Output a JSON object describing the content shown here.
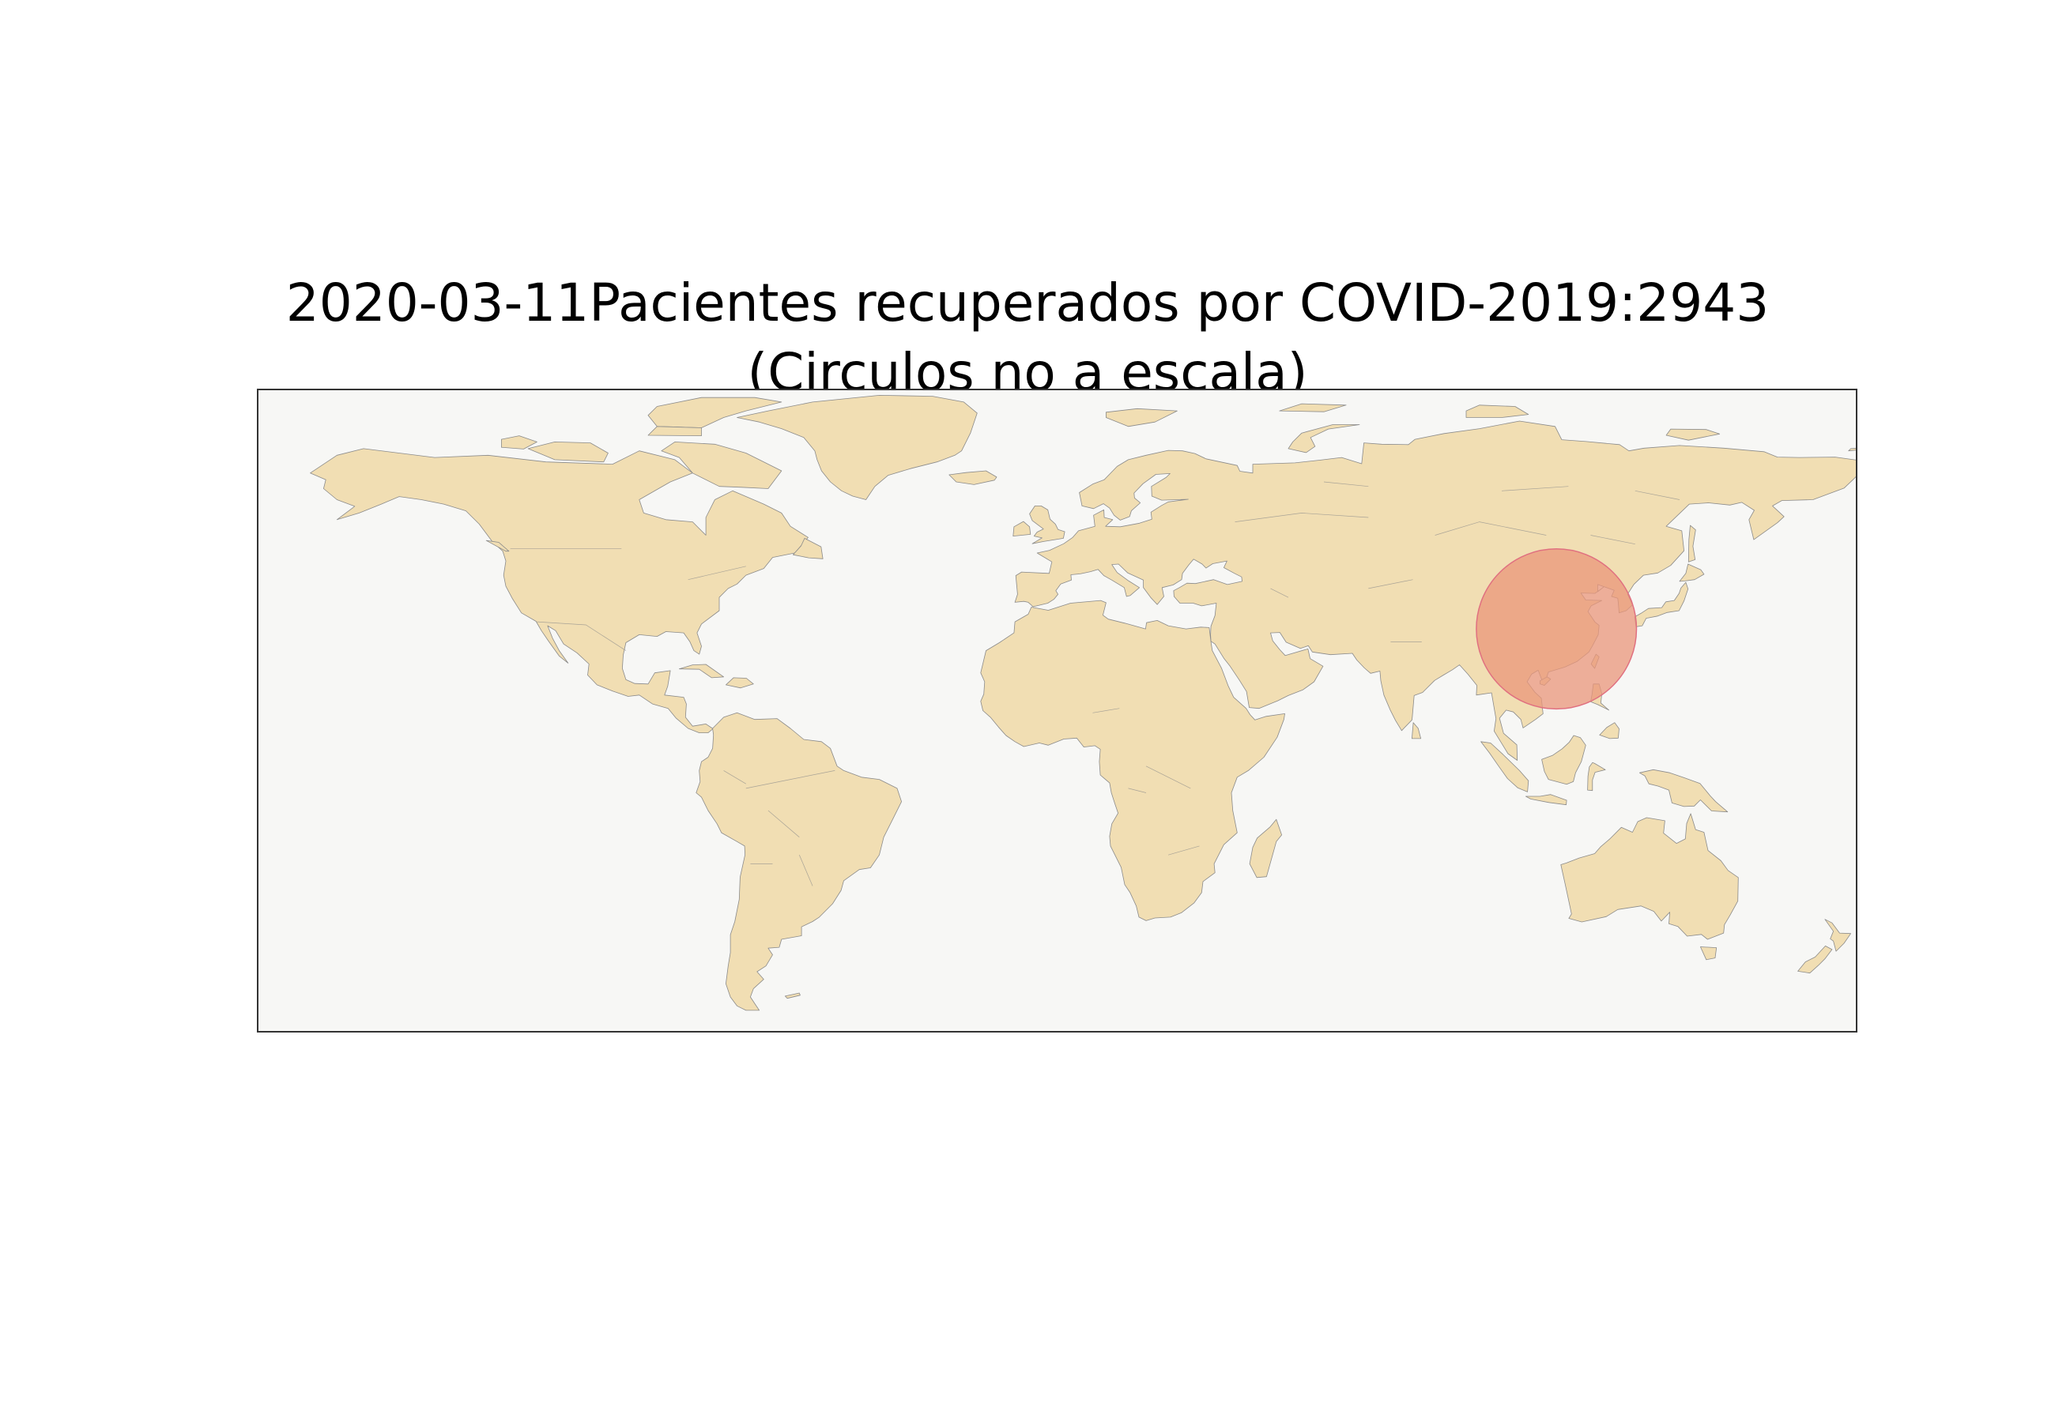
{
  "map": {
    "title_line1": "2020-03-11Pacientes recuperados por COVID-2019:2943",
    "title_line2": "(Circulos no a escala)",
    "ocean_color": "#f7f7f5",
    "land_color": "#f1deb3",
    "border_color": "#8a8a8a",
    "frame_color": "#333333",
    "lon_range": [
      -180,
      180
    ],
    "lat_range": [
      -60,
      85
    ],
    "markers": [
      {
        "lon": 112.3,
        "lat": 30.9,
        "radius_deg": 18,
        "fill": "#e9967a",
        "outline": "#e07080",
        "opacity": 0.75
      }
    ]
  }
}
